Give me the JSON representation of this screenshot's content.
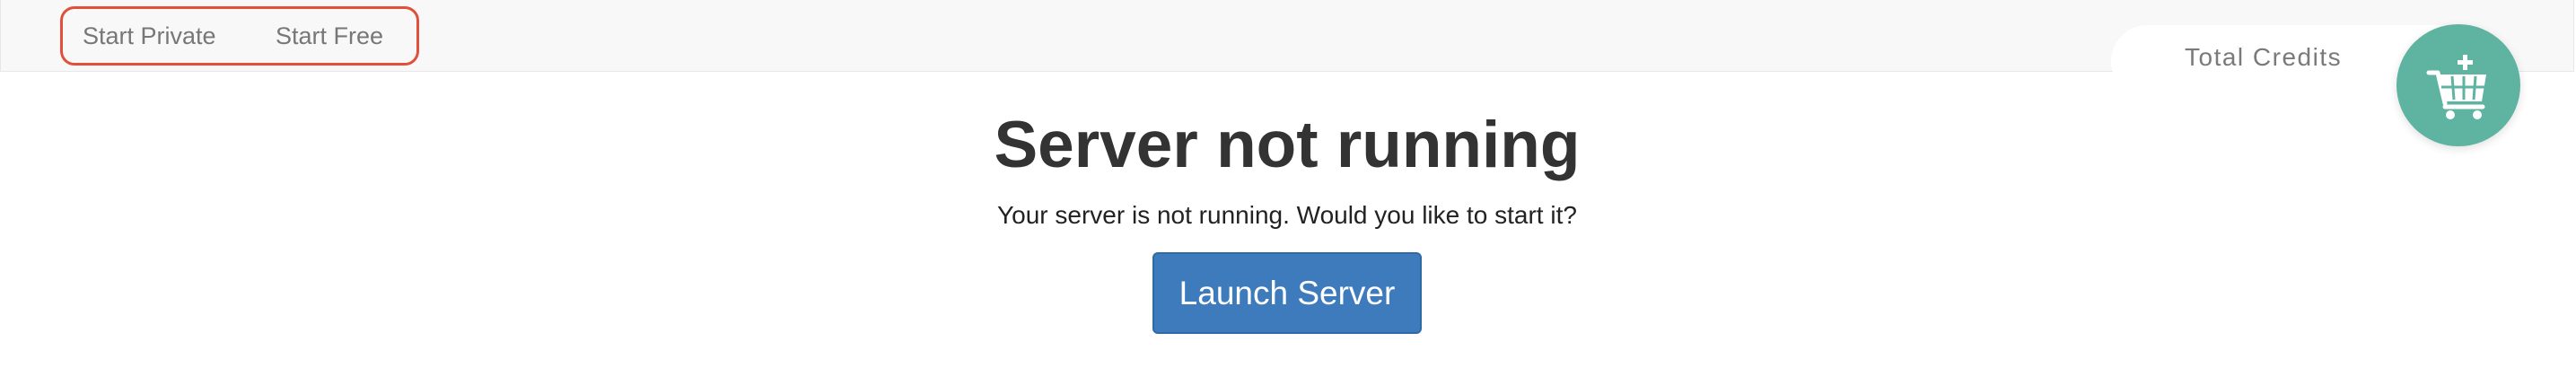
{
  "navbar": {
    "links": [
      {
        "label": "Start Private"
      },
      {
        "label": "Start Free"
      }
    ],
    "highlight_color": "#e0503a"
  },
  "credits": {
    "label": "Total Credits",
    "cart_icon": "add-to-cart-icon",
    "cart_color": "#5fb3a1"
  },
  "main": {
    "title": "Server not running",
    "message": "Your server is not running. Would you like to start it?",
    "launch_label": "Launch Server",
    "launch_color": "#3d7bbc"
  }
}
